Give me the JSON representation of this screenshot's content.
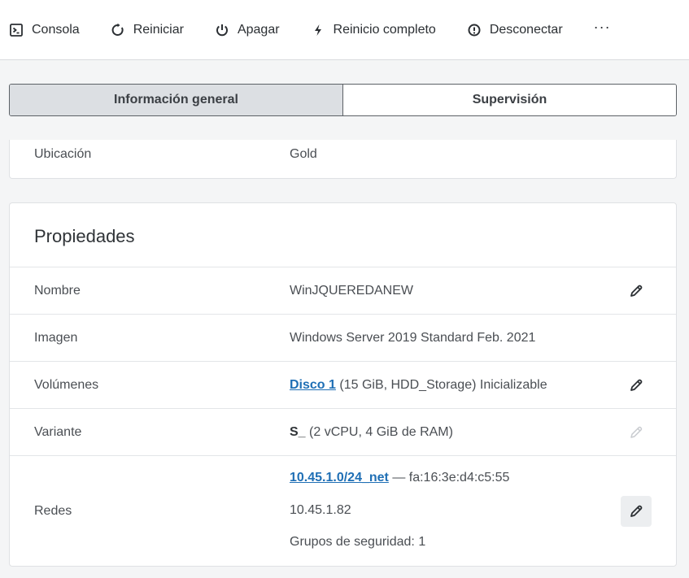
{
  "toolbar": {
    "items": [
      {
        "label": "Consola",
        "icon": "console-icon"
      },
      {
        "label": "Reiniciar",
        "icon": "restart-icon"
      },
      {
        "label": "Apagar",
        "icon": "power-icon"
      },
      {
        "label": "Reinicio completo",
        "icon": "lightning-icon"
      },
      {
        "label": "Desconectar",
        "icon": "disconnect-icon"
      }
    ],
    "more": "···"
  },
  "tabs": [
    {
      "label": "Información general",
      "active": true
    },
    {
      "label": "Supervisión",
      "active": false
    }
  ],
  "location": {
    "label": "Ubicación",
    "value": "Gold"
  },
  "properties": {
    "title": "Propiedades",
    "name": {
      "label": "Nombre",
      "value": "WinJQUEREDANEW"
    },
    "image": {
      "label": "Imagen",
      "value": "Windows Server 2019 Standard Feb. 2021"
    },
    "volumes": {
      "label": "Volúmenes",
      "link": "Disco 1",
      "detail": " (15 GiB, HDD_Storage) Inicializable"
    },
    "flavor": {
      "label": "Variante",
      "name": "S_",
      "detail": " (2 vCPU, 4 GiB de RAM)"
    },
    "networks": {
      "label": "Redes",
      "link": "10.45.1.0/24_net",
      "mac": " — fa:16:3e:d4:c5:55",
      "ip": "10.45.1.82",
      "security_groups": "Grupos de seguridad: 1"
    }
  },
  "colors": {
    "link": "#1f6fb5",
    "active_tab": "#dcdfe3"
  }
}
